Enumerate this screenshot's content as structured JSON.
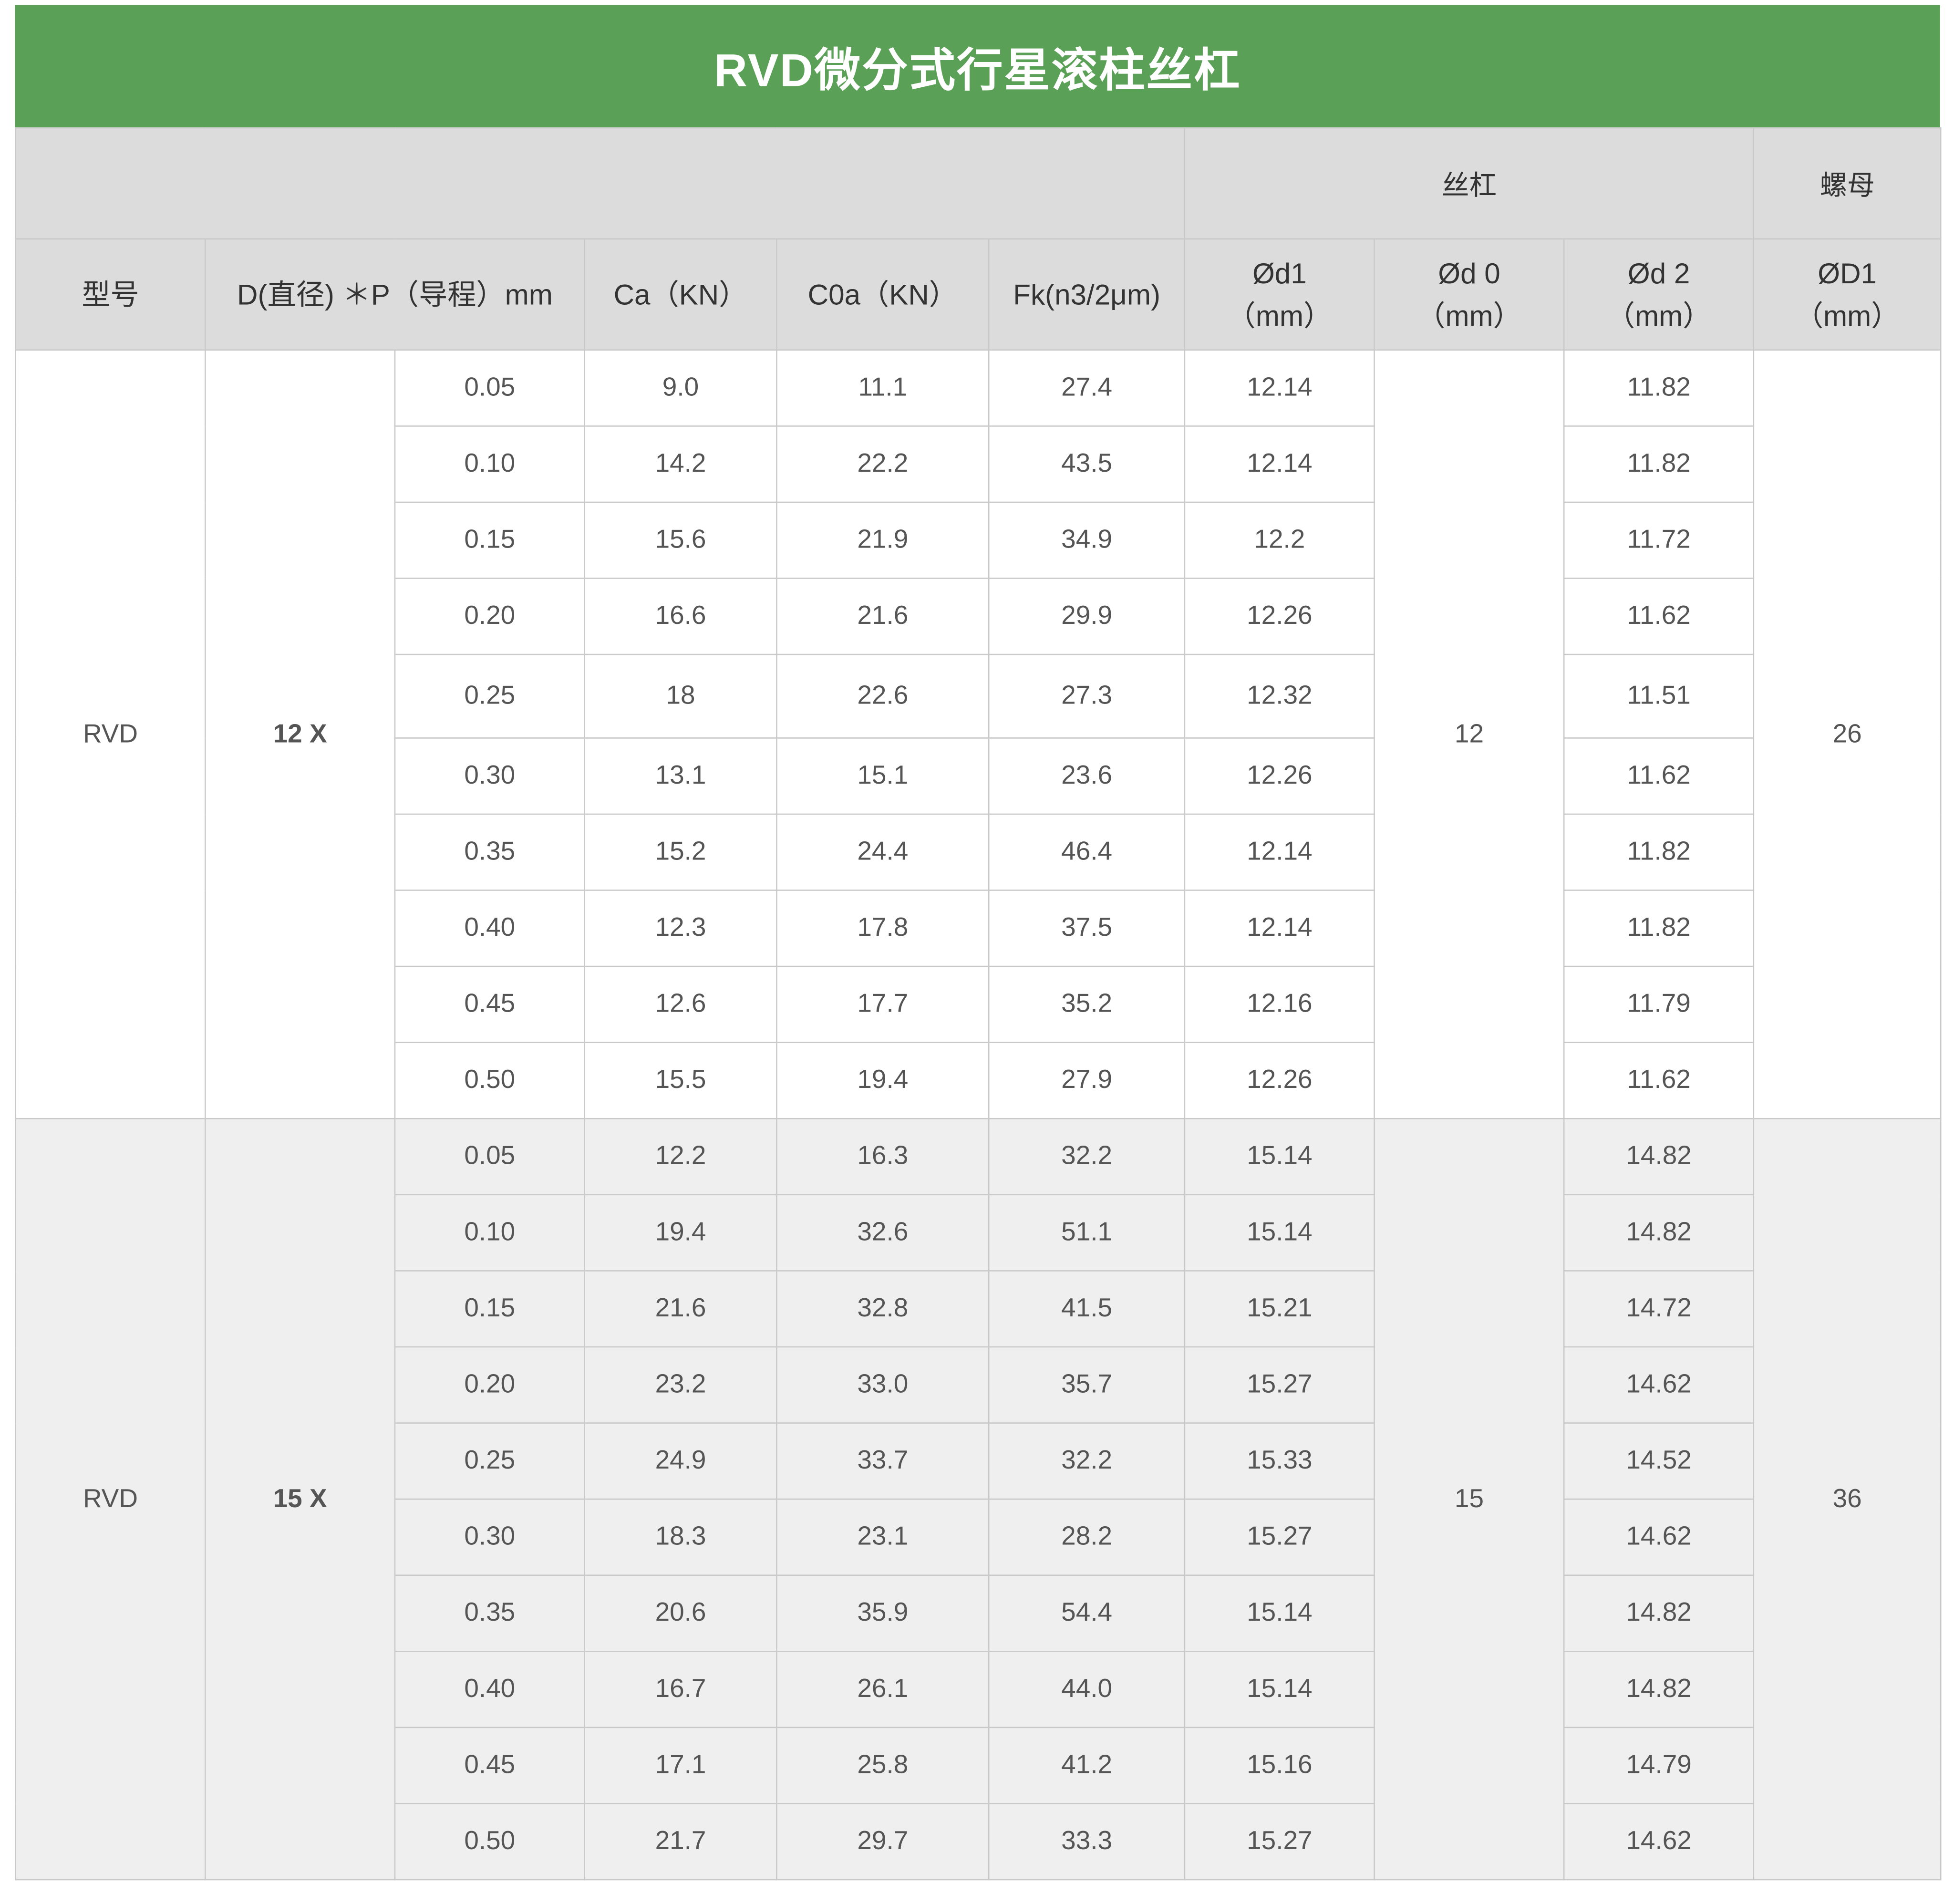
{
  "title": "RVD微分式行星滚柱丝杠",
  "group_headers": {
    "screw": "丝杠",
    "nut": "螺母"
  },
  "columns": {
    "model": "型号",
    "dp": "D(直径) ＊P（导程）mm",
    "ca": "Ca（KN）",
    "c0a": "C0a（KN）",
    "fk": "Fk(n3/2μm)",
    "d1": "Ød1",
    "d0": "Ød 0",
    "d2": "Ød 2",
    "D1": "ØD1",
    "unit": "（mm）"
  },
  "groups": [
    {
      "model": "RVD",
      "size": "12 X",
      "d0": "12",
      "D1": "26",
      "rows": [
        {
          "p": "0.05",
          "ca": "9.0",
          "c0a": "11.1",
          "fk": "27.4",
          "d1": "12.14",
          "d2": "11.82"
        },
        {
          "p": "0.10",
          "ca": "14.2",
          "c0a": "22.2",
          "fk": "43.5",
          "d1": "12.14",
          "d2": "11.82"
        },
        {
          "p": "0.15",
          "ca": "15.6",
          "c0a": "21.9",
          "fk": "34.9",
          "d1": "12.2",
          "d2": "11.72"
        },
        {
          "p": "0.20",
          "ca": "16.6",
          "c0a": "21.6",
          "fk": "29.9",
          "d1": "12.26",
          "d2": "11.62"
        },
        {
          "p": "0.25",
          "ca": "18",
          "c0a": "22.6",
          "fk": "27.3",
          "d1": "12.32",
          "d2": "11.51"
        },
        {
          "p": "0.30",
          "ca": "13.1",
          "c0a": "15.1",
          "fk": "23.6",
          "d1": "12.26",
          "d2": "11.62"
        },
        {
          "p": "0.35",
          "ca": "15.2",
          "c0a": "24.4",
          "fk": "46.4",
          "d1": "12.14",
          "d2": "11.82"
        },
        {
          "p": "0.40",
          "ca": "12.3",
          "c0a": "17.8",
          "fk": "37.5",
          "d1": "12.14",
          "d2": "11.82"
        },
        {
          "p": "0.45",
          "ca": "12.6",
          "c0a": "17.7",
          "fk": "35.2",
          "d1": "12.16",
          "d2": "11.79"
        },
        {
          "p": "0.50",
          "ca": "15.5",
          "c0a": "19.4",
          "fk": "27.9",
          "d1": "12.26",
          "d2": "11.62"
        }
      ]
    },
    {
      "model": "RVD",
      "size": "15 X",
      "d0": "15",
      "D1": "36",
      "rows": [
        {
          "p": "0.05",
          "ca": "12.2",
          "c0a": "16.3",
          "fk": "32.2",
          "d1": "15.14",
          "d2": "14.82"
        },
        {
          "p": "0.10",
          "ca": "19.4",
          "c0a": "32.6",
          "fk": "51.1",
          "d1": "15.14",
          "d2": "14.82"
        },
        {
          "p": "0.15",
          "ca": "21.6",
          "c0a": "32.8",
          "fk": "41.5",
          "d1": "15.21",
          "d2": "14.72"
        },
        {
          "p": "0.20",
          "ca": "23.2",
          "c0a": "33.0",
          "fk": "35.7",
          "d1": "15.27",
          "d2": "14.62"
        },
        {
          "p": "0.25",
          "ca": "24.9",
          "c0a": "33.7",
          "fk": "32.2",
          "d1": "15.33",
          "d2": "14.52"
        },
        {
          "p": "0.30",
          "ca": "18.3",
          "c0a": "23.1",
          "fk": "28.2",
          "d1": "15.27",
          "d2": "14.62"
        },
        {
          "p": "0.35",
          "ca": "20.6",
          "c0a": "35.9",
          "fk": "54.4",
          "d1": "15.14",
          "d2": "14.82"
        },
        {
          "p": "0.40",
          "ca": "16.7",
          "c0a": "26.1",
          "fk": "44.0",
          "d1": "15.14",
          "d2": "14.82"
        },
        {
          "p": "0.45",
          "ca": "17.1",
          "c0a": "25.8",
          "fk": "41.2",
          "d1": "15.16",
          "d2": "14.79"
        },
        {
          "p": "0.50",
          "ca": "21.7",
          "c0a": "29.7",
          "fk": "33.3",
          "d1": "15.27",
          "d2": "14.62"
        }
      ]
    }
  ]
}
